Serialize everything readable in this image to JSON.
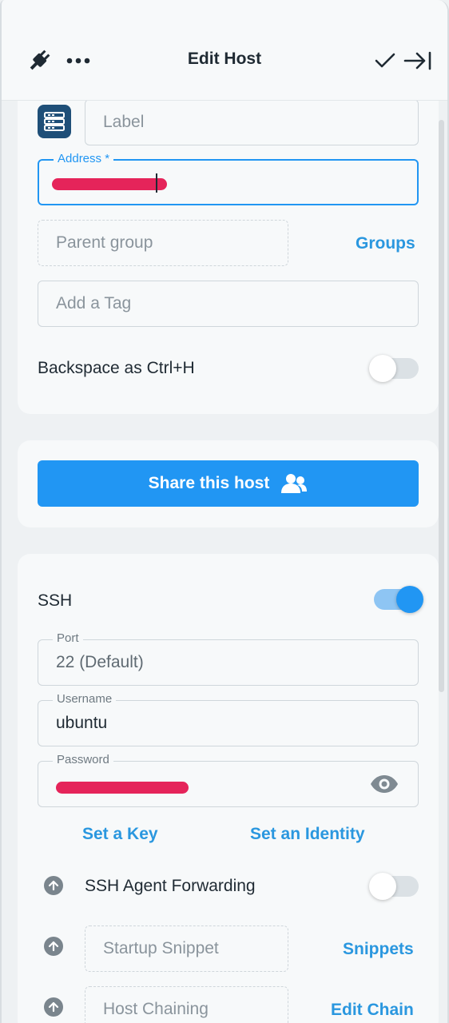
{
  "header": {
    "title": "Edit Host",
    "icons": [
      "plug-icon",
      "more-icon",
      "check-icon",
      "collapse-panel-icon"
    ]
  },
  "general": {
    "label_placeholder": "Label",
    "address_label": "Address *",
    "parent_group_placeholder": "Parent group",
    "groups_link": "Groups",
    "tag_placeholder": "Add a Tag",
    "backspace_label": "Backspace as Ctrl+H",
    "backspace_enabled": false
  },
  "share": {
    "button_label": "Share this host"
  },
  "ssh": {
    "label": "SSH",
    "enabled": true,
    "port_label": "Port",
    "port_value": "22 (Default)",
    "username_label": "Username",
    "username_value": "ubuntu",
    "password_label": "Password",
    "set_key_link": "Set a Key",
    "set_identity_link": "Set an Identity",
    "agent_forwarding_label": "SSH Agent Forwarding",
    "agent_forwarding_enabled": false,
    "startup_snippet_placeholder": "Startup Snippet",
    "snippets_link": "Snippets",
    "host_chaining_placeholder": "Host Chaining",
    "edit_chain_link": "Edit Chain"
  },
  "colors": {
    "accent": "#2196f3",
    "link": "#2a97df",
    "redaction": "#e5245a",
    "server_icon_bg": "#1f4f78"
  }
}
